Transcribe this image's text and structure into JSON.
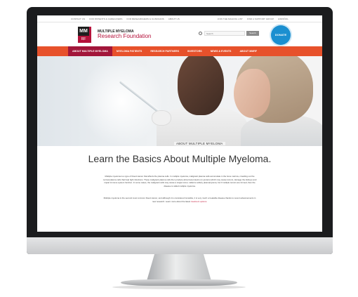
{
  "utility_links_left": [
    "Contact Us",
    "For Patients & Caregivers",
    "For Researchers & Clinicians",
    "About Us"
  ],
  "utility_links_right": [
    "Join the Mailing List",
    "Find a Support Group",
    "Español"
  ],
  "logo": {
    "mark_top": "MM",
    "mark_bottom": "RF"
  },
  "organization": {
    "line1": "MULTIPLE MYELOMA",
    "line2": "Research Foundation"
  },
  "search": {
    "placeholder": "Search",
    "button_label": "Search"
  },
  "donate": {
    "label": "DONATE"
  },
  "nav": [
    "About Multiple Myeloma",
    "Myeloma Patients",
    "Research Partners",
    "Investors",
    "News & Events",
    "About MMRF"
  ],
  "hero": {
    "label": "About Multiple Myeloma"
  },
  "main": {
    "headline": "Learn the Basics About Multiple Myeloma.",
    "paragraph1": "Multiple myeloma is a type of blood cancer that affects the plasma cells. In multiple myeloma, malignant plasma cells accumulate in the bone marrow, crowding out the normal plasma cells that help fight infections. These malignant plasma cells then produce abnormal proteins (m-protein) which may cause tumors, damage the kidneys and impair immune system function. In some cases, the malignant cells may cause a single tumor, called a solitary plasmacytoma, but if multiple tumors are formed, then the disease is called multiple myeloma.",
    "paragraph2": "Multiple myeloma is the second most common blood cancer, and although it is considered incurable, it is very much a treatable disease thanks to recent advancements in new research. Learn more about the latest",
    "paragraph2_link": "treatment options."
  },
  "colors": {
    "nav": "#e7512b",
    "nav_active": "#a2163a",
    "brand_red": "#b5123b",
    "donate": "#1b8fd0"
  }
}
